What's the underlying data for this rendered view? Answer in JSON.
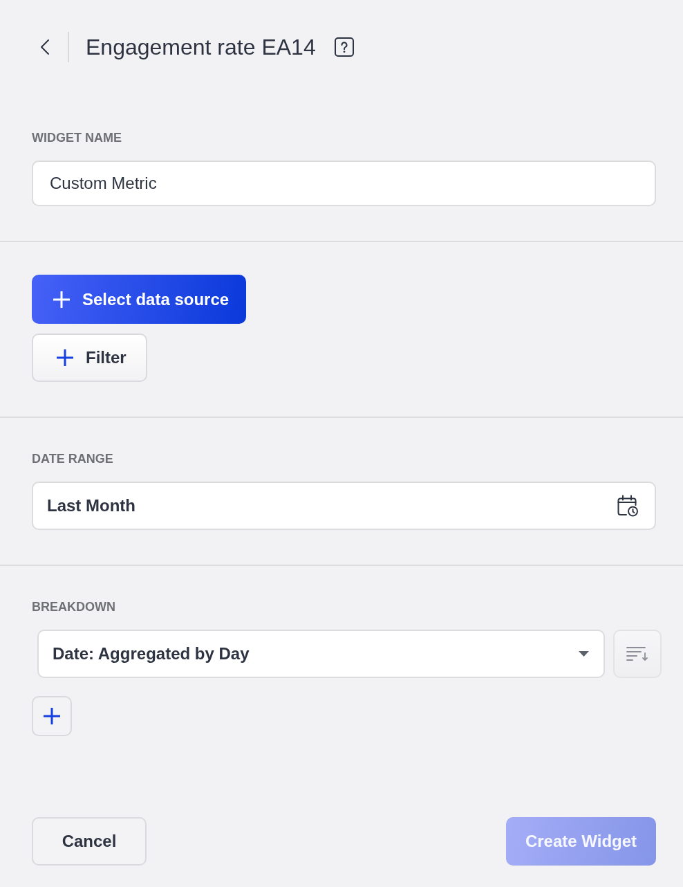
{
  "header": {
    "title": "Engagement rate EA14"
  },
  "widget_name": {
    "label": "WIDGET NAME",
    "value": "Custom Metric"
  },
  "data_source": {
    "buttons": [
      {
        "kind": "primary",
        "label": "Select data source"
      },
      {
        "kind": "secondary",
        "label": "Filter"
      }
    ]
  },
  "date_range": {
    "label": "DATE RANGE",
    "value": "Last Month"
  },
  "breakdown": {
    "label": "BREAKDOWN",
    "value": "Date: Aggregated by Day"
  },
  "footer": {
    "buttons": [
      {
        "kind": "secondary",
        "label": "Cancel",
        "disabled": false
      },
      {
        "kind": "primary",
        "label": "Create Widget",
        "disabled": true
      }
    ]
  }
}
